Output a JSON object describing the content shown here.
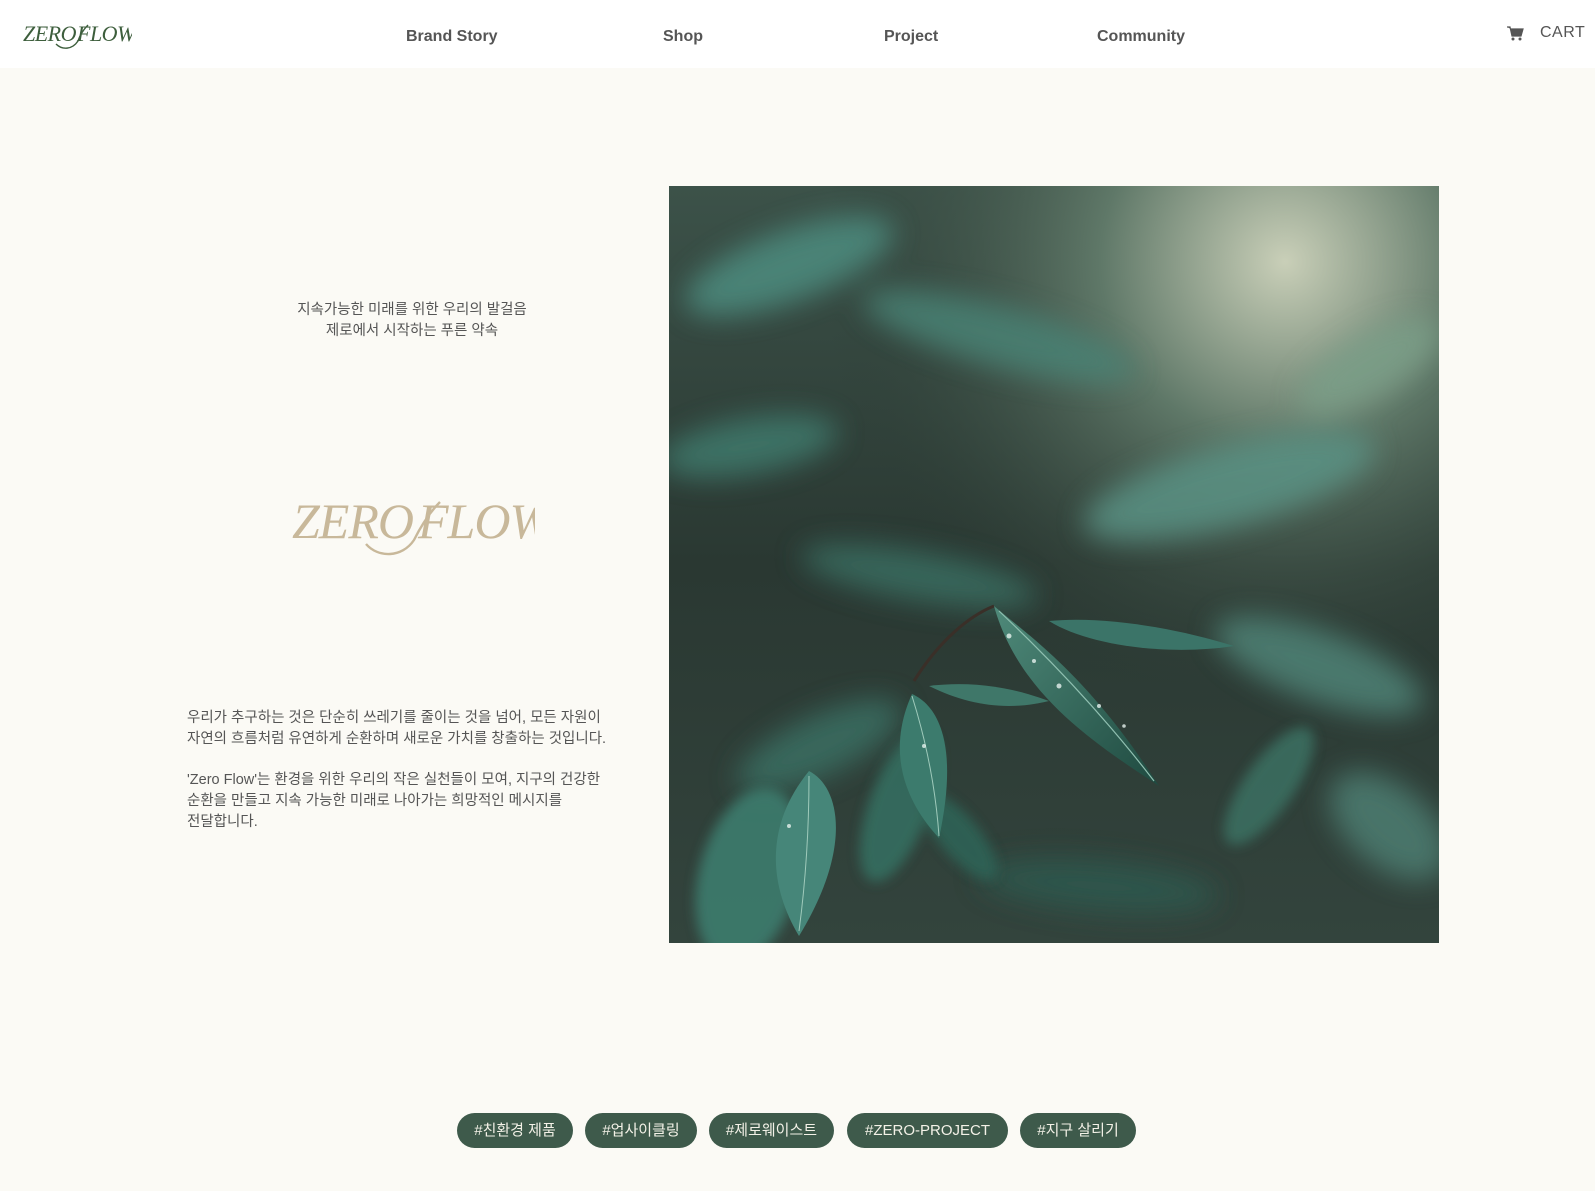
{
  "header": {
    "logo_text": "ZERO FLOW",
    "nav": [
      {
        "label": "Brand Story"
      },
      {
        "label": "Shop"
      },
      {
        "label": "Project"
      },
      {
        "label": "Community"
      }
    ],
    "cart_label": "CART"
  },
  "main": {
    "tagline": [
      "지속가능한 미래를 위한 우리의 발걸음",
      "제로에서 시작하는 푸른 약속"
    ],
    "brand_logo_text": "ZERO FLOW",
    "description": {
      "paragraph1": [
        "우리가 추구하는 것은 단순히 쓰레기를 줄이는 것을 넘어, 모든 자원이",
        "자연의 흐름처럼 유연하게 순환하며 새로운 가치를 창출하는 것입니다."
      ],
      "paragraph2": [
        "'Zero Flow'는 환경을 위한 우리의 작은 실천들이 모여, 지구의 건강한",
        "순환을 만들고 지속 가능한 미래로 나아가는 희망적인 메시지를",
        "전달합니다."
      ]
    }
  },
  "tags": [
    "#친환경 제품",
    "#업사이클링",
    "#제로웨이스트",
    "#ZERO-PROJECT",
    "#지구 살리기"
  ],
  "colors": {
    "background": "#fbfaf5",
    "header_bg": "#ffffff",
    "logo_green": "#3d5e3c",
    "brand_beige": "#c8b89a",
    "tag_bg": "#3e5a4b",
    "tag_text": "#f3f1e7"
  }
}
